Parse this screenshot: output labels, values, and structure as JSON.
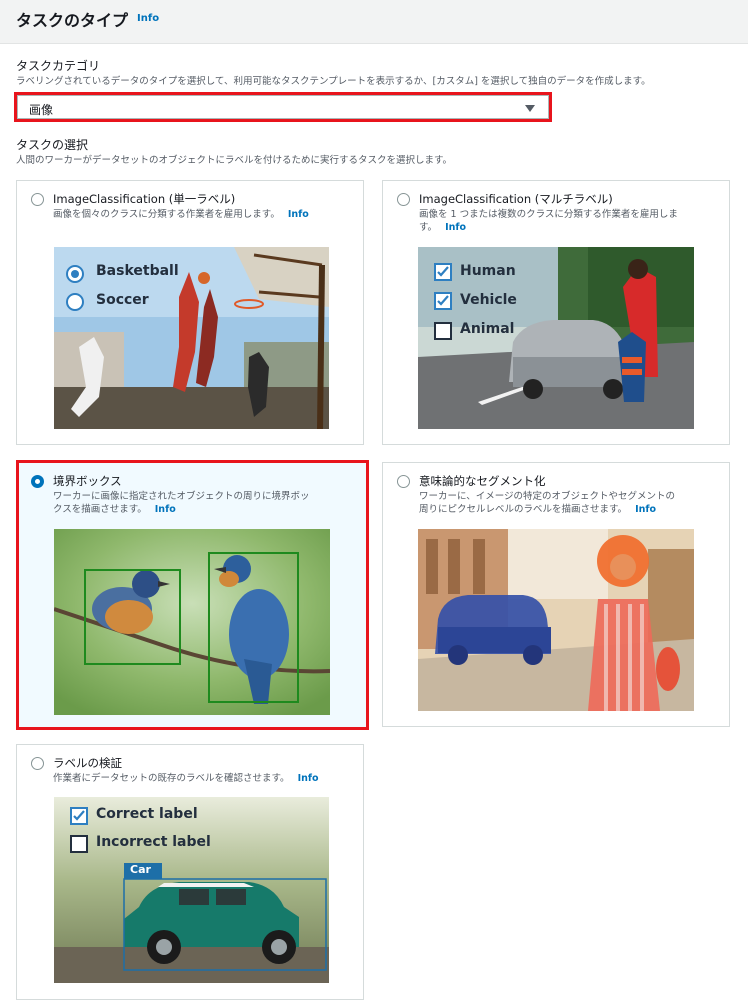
{
  "header": {
    "title": "タスクのタイプ",
    "info": "Info"
  },
  "category": {
    "label": "タスクカテゴリ",
    "description": "ラベリングされているデータのタイプを選択して、利用可能なタスクテンプレートを表示するか、[カスタム] を選択して独自のデータを作成します。",
    "selected_value": "画像"
  },
  "task_selection": {
    "label": "タスクの選択",
    "description": "人間のワーカーがデータセットのオブジェクトにラベルを付けるために実行するタスクを選択します。"
  },
  "cards": [
    {
      "title": "ImageClassification (単一ラベル)",
      "desc_line1": "画像を個々のクラスに分類する作業者を雇用します。",
      "desc_line2": "",
      "info": "Info",
      "selected": false,
      "overlay": [
        "Basketball",
        "Soccer"
      ]
    },
    {
      "title": "ImageClassification (マルチラベル)",
      "desc_line1": "画像を 1 つまたは複数のクラスに分類する作業者を雇用しま",
      "desc_line2": "す。",
      "info": "Info",
      "selected": false,
      "overlay": [
        "Human",
        "Vehicle",
        "Animal"
      ]
    },
    {
      "title": "境界ボックス",
      "desc_line1": "ワーカーに画像に指定されたオブジェクトの周りに境界ボッ",
      "desc_line2": "クスを描画させます。",
      "info": "Info",
      "selected": true
    },
    {
      "title": "意味論的なセグメント化",
      "desc_line1": "ワーカーに、イメージの特定のオブジェクトやセグメントの",
      "desc_line2": "周りにピクセルレベルのラベルを描画させます。",
      "info": "Info",
      "selected": false
    },
    {
      "title": "ラベルの検証",
      "desc_line1": "作業者にデータセットの既存のラベルを確認させます。",
      "desc_line2": "",
      "info": "Info",
      "selected": false,
      "overlay": [
        "Correct label",
        "Incorrect label"
      ],
      "box_label": "Car"
    }
  ],
  "colors": {
    "accent": "#0073bb",
    "highlight": "#e8141c",
    "checkbox": "#2e7fc1"
  }
}
